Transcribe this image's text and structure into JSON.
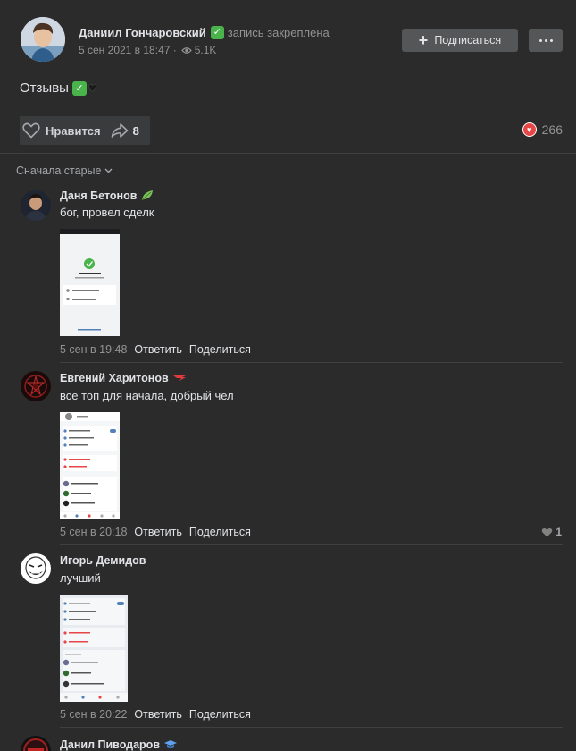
{
  "post": {
    "author_name": "Даниил Гончаровский",
    "pinned_text": "запись закреплена",
    "date": "5 сен 2021 в 18:47 ·",
    "views": "5.1K",
    "subscribe_label": "Подписаться",
    "text": "Отзывы",
    "like_label": "Нравится",
    "share_count": "8",
    "reaction_count": "266"
  },
  "sort_label": "Сначала старые",
  "comments": [
    {
      "name": "Даня Бетонов",
      "text": "бог, провел сделк",
      "date": "5 сен в 19:48",
      "reply_label": "Ответить",
      "share_label": "Поделиться",
      "badge": "leaf-badge-icon"
    },
    {
      "name": "Евгений Харитонов",
      "text": "все топ для начала, добрый чел",
      "date": "5 сен в 20:18",
      "reply_label": "Ответить",
      "share_label": "Поделиться",
      "likes": "1",
      "badge": "red-wing-badge-icon"
    },
    {
      "name": "Игорь Демидов",
      "text": "лучший",
      "date": "5 сен в 20:22",
      "reply_label": "Ответить",
      "share_label": "Поделиться"
    },
    {
      "name": "Данил Пиводаров",
      "badge": "graduation-cap-badge-icon"
    }
  ],
  "colors": {
    "background": "#2b2b2c",
    "button": "#555658",
    "accent_green": "#4bb34b",
    "heart_red": "#e64646",
    "muted_text": "#939393"
  }
}
